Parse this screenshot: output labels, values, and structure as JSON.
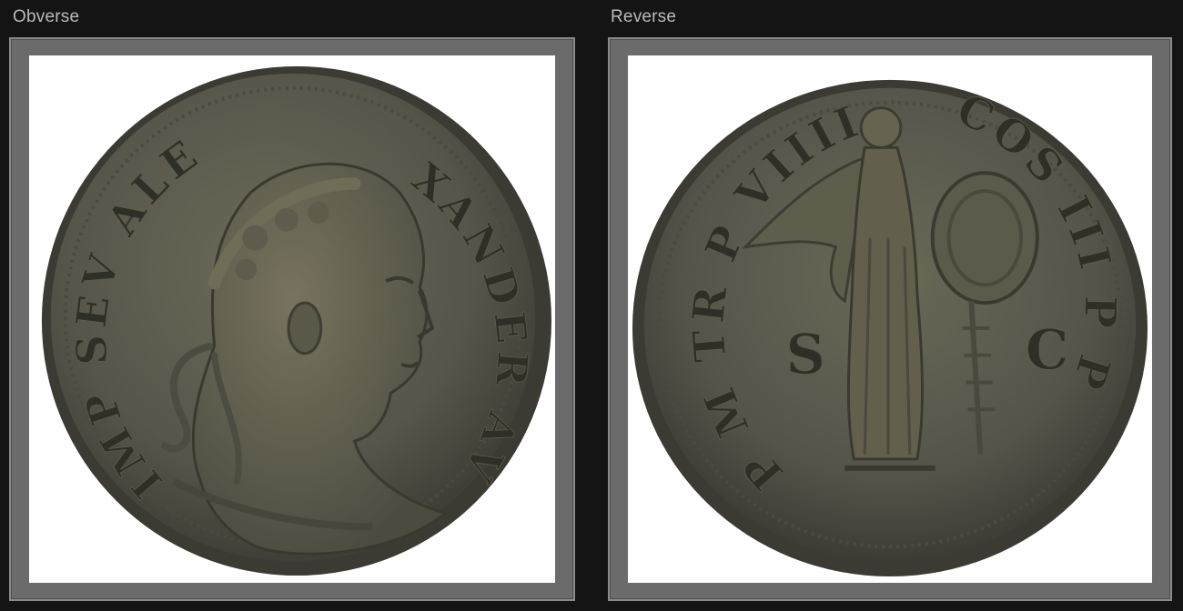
{
  "panels": {
    "obverse": {
      "label": "Obverse",
      "legend_left": "IMP SEV ALE",
      "legend_right": "XANDER AV",
      "icon": "laureate-emperor-bust-icon"
    },
    "reverse": {
      "label": "Reverse",
      "legend_left": "P M TR P VIIII",
      "legend_right": "COS III P P",
      "field_left": "S",
      "field_right": "C",
      "icon": "victory-with-shield-icon"
    }
  },
  "colors": {
    "background": "#141414",
    "frame": "#6b6b6b",
    "coin_bronze": "#585748",
    "label_text": "#b9b9b9"
  }
}
